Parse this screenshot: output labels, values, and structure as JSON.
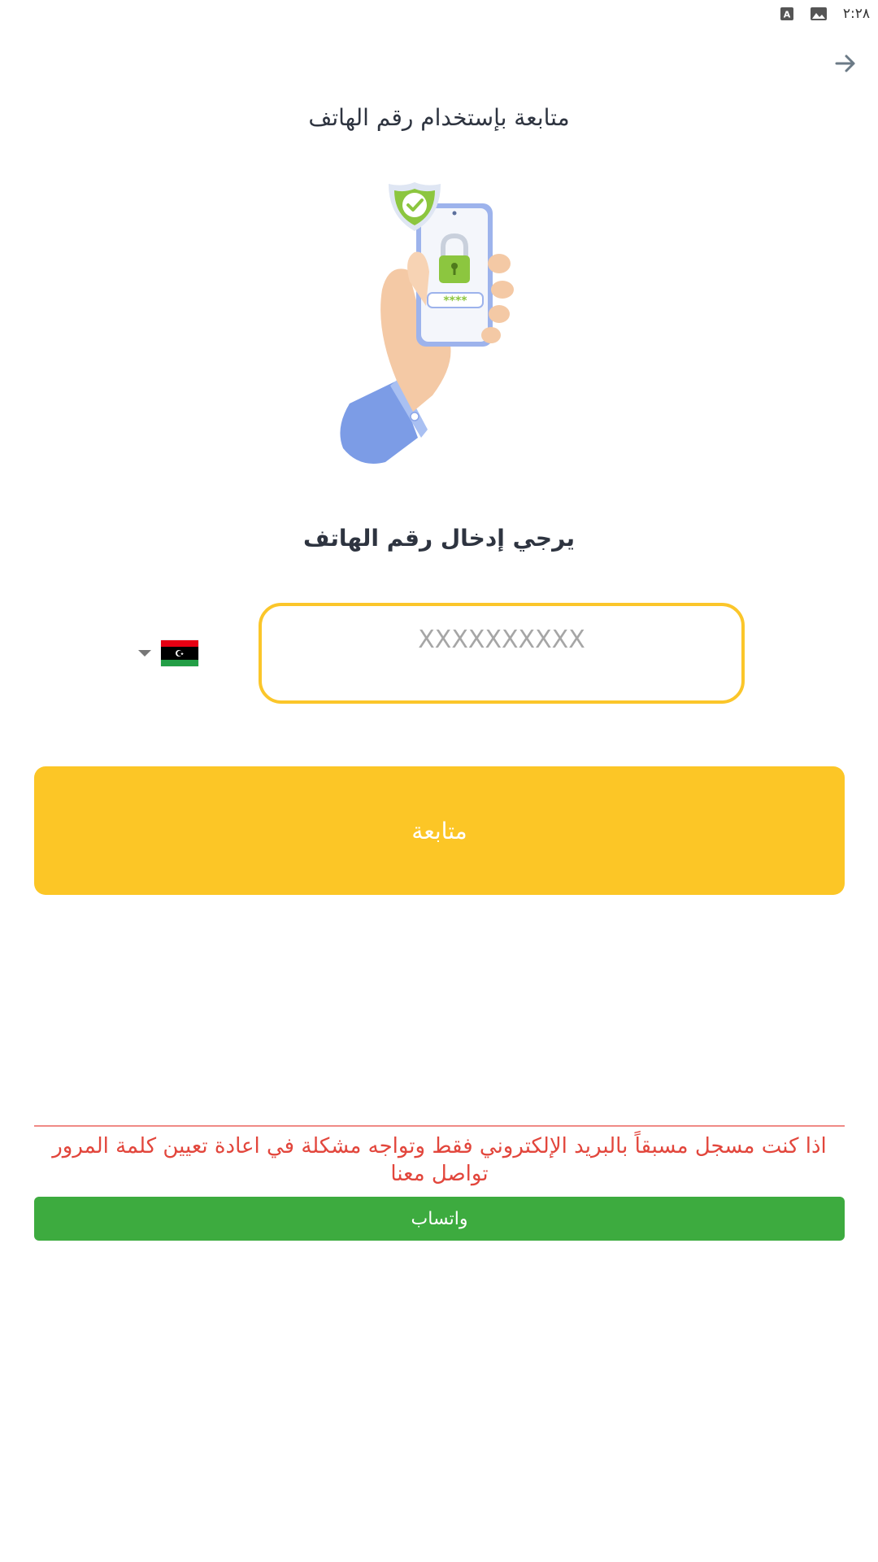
{
  "status_bar": {
    "time": "٢:٢٨",
    "icons": [
      "gallery-icon",
      "keyboard-a-icon"
    ]
  },
  "header": {
    "title": "متابعة بإستخدام رقم الهاتف",
    "back_icon": "arrow-right-icon"
  },
  "prompt": "يرجي إدخال رقم الهاتف",
  "phone": {
    "country_flag": "Libya",
    "value": "",
    "placeholder": "XXXXXXXXXX"
  },
  "buttons": {
    "continue_label": "متابعة",
    "whatsapp_label": "واتساب"
  },
  "help_text": "اذا كنت مسجل مسبقاً بالبريد الإلكتروني فقط وتواجه مشكلة في اعادة تعيين كلمة المرور تواصل معنا",
  "colors": {
    "accent": "#fcc626",
    "input_border": "#fbc62a",
    "help_text": "#e2463c",
    "whatsapp": "#3dab3f",
    "title_text": "#2e3440"
  }
}
